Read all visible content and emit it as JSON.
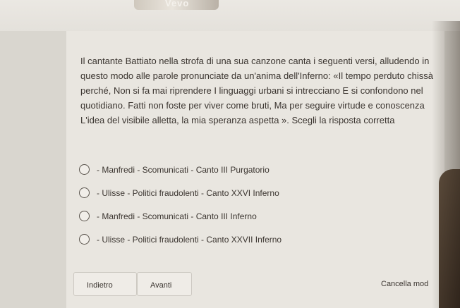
{
  "banner": {
    "text": "Vevo"
  },
  "question": {
    "text": "Il cantante Battiato nella strofa di una sua canzone canta i seguenti versi, alludendo in questo modo alle parole pronunciate da un'anima dell'Inferno: «Il tempo perduto chissà perché, Non si fa mai riprendere I linguaggi urbani si intrecciano E si confondono nel quotidiano. Fatti non foste per viver come bruti, Ma per seguire virtude e conoscenza L'idea del visibile alletta, la mia speranza aspetta ». Scegli la risposta corretta"
  },
  "options": [
    {
      "label": "- Manfredi - Scomunicati - Canto III Purgatorio"
    },
    {
      "label": "- Ulisse - Politici fraudolenti - Canto XXVI Inferno"
    },
    {
      "label": "- Manfredi - Scomunicati - Canto III Inferno"
    },
    {
      "label": "- Ulisse - Politici fraudolenti - Canto XXVII Inferno"
    }
  ],
  "buttons": {
    "back": "Indietro",
    "next": "Avanti",
    "cancel": "Cancella mod"
  }
}
